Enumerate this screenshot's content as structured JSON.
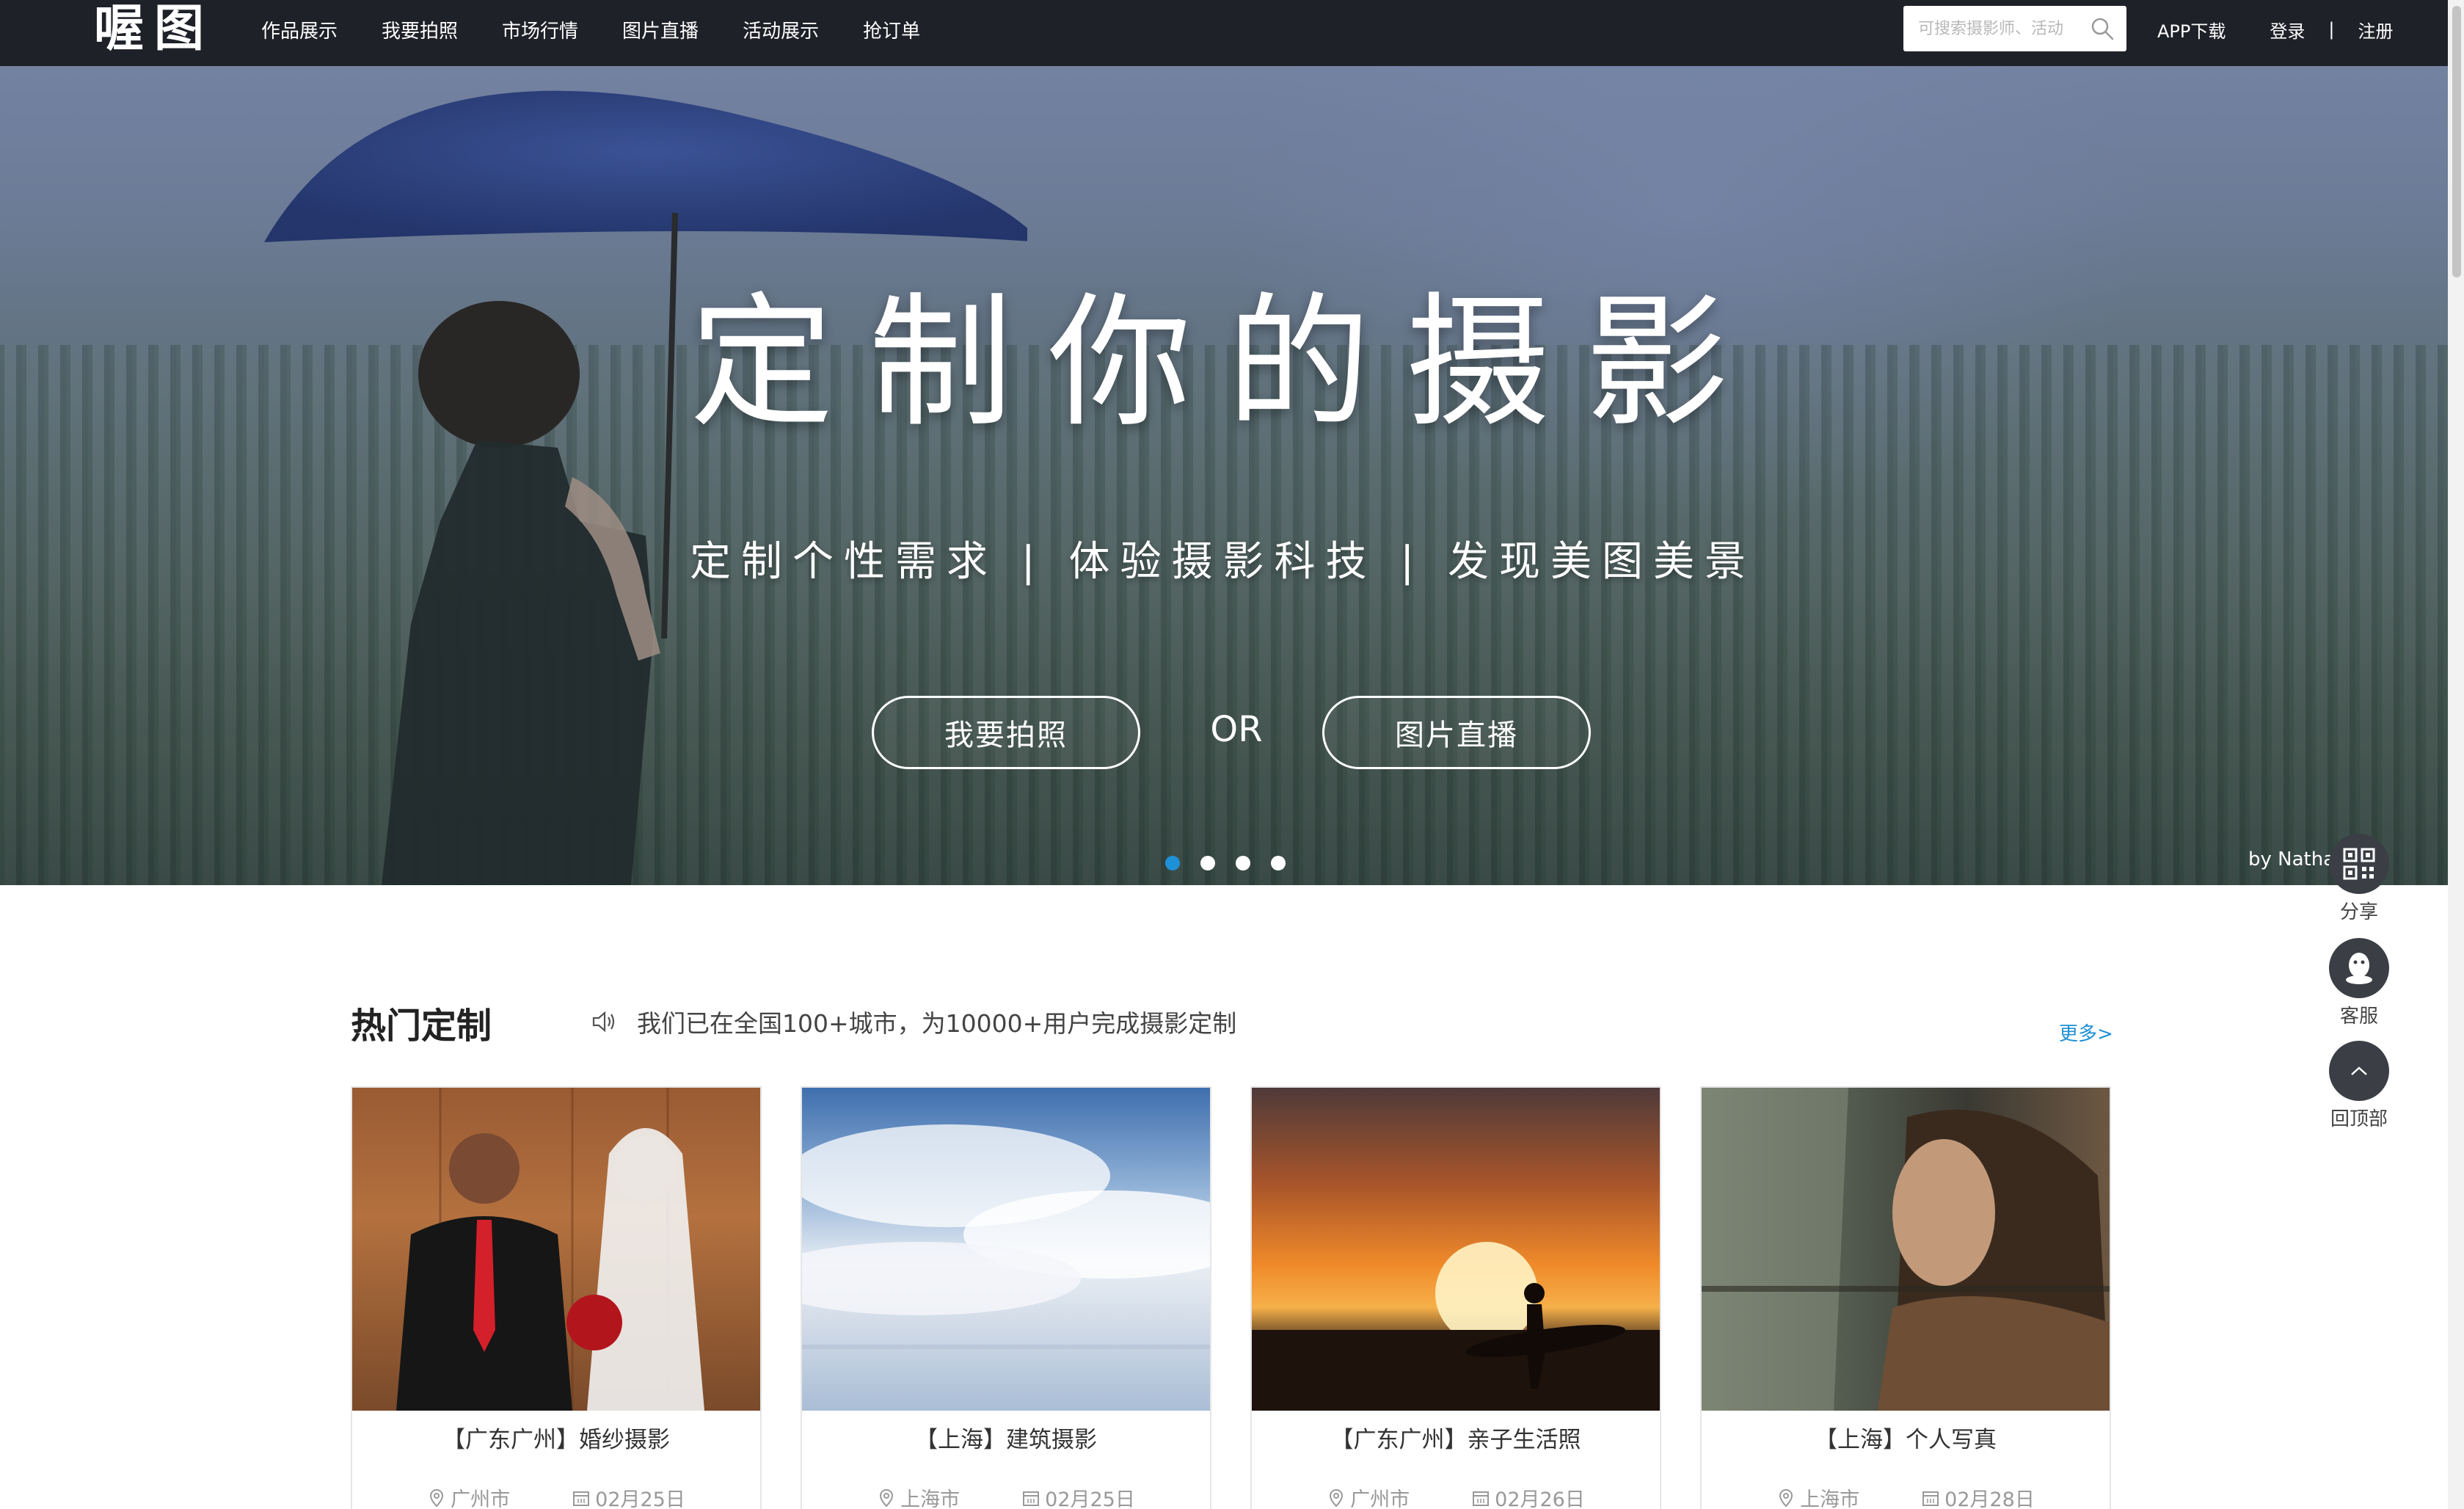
{
  "brand": {
    "logo_text": "喔图"
  },
  "nav": {
    "items": [
      "作品展示",
      "我要拍照",
      "市场行情",
      "图片直播",
      "活动展示",
      "抢订单"
    ]
  },
  "search": {
    "placeholder": "可搜索摄影师、活动"
  },
  "top_links": {
    "app": "APP下载",
    "login": "登录",
    "separator": "|",
    "register": "注册"
  },
  "hero": {
    "title": "定制你的摄影",
    "subtitle": "定制个性需求 | 体验摄影科技 | 发现美图美景",
    "button_photo": "我要拍照",
    "or_text": "OR",
    "button_live": "图片直播",
    "credit": "by  Natha",
    "slides_total": 4,
    "active_slide": 1
  },
  "side_tools": {
    "share": "分享",
    "service": "客服",
    "top": "回顶部"
  },
  "section": {
    "title": "热门定制",
    "notice": "我们已在全国100+城市，为10000+用户完成摄影定制",
    "more": "更多>"
  },
  "cards": [
    {
      "title": "【广东广州】婚纱摄影",
      "city": "广州市",
      "date": "02月25日"
    },
    {
      "title": "【上海】建筑摄影",
      "city": "上海市",
      "date": "02月25日"
    },
    {
      "title": "【广东广州】亲子生活照",
      "city": "广州市",
      "date": "02月26日"
    },
    {
      "title": "【上海】个人写真",
      "city": "上海市",
      "date": "02月28日"
    }
  ],
  "colors": {
    "topbar": "#1f2128",
    "accent": "#1e90d6"
  }
}
